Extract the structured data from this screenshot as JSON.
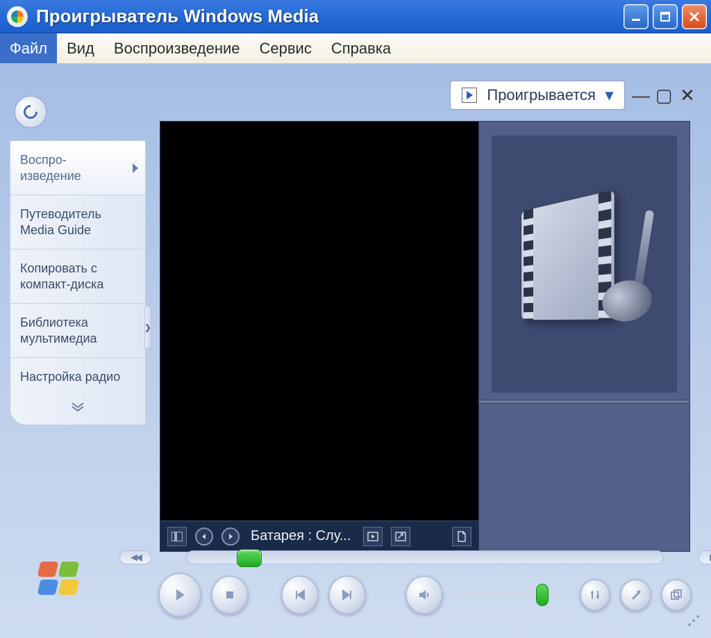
{
  "title": "Проигрыватель Windows Media",
  "menubar": {
    "file": "Файл",
    "view": "Вид",
    "playback": "Воспроизведение",
    "tools": "Сервис",
    "help": "Справка"
  },
  "nowPlayingDropdown": {
    "label": "Проигрывается"
  },
  "sidebar": {
    "tabs": [
      {
        "label": "Воспро-\nизведение"
      },
      {
        "label": "Путеводитель Media Guide"
      },
      {
        "label": "Копировать с компакт-диска"
      },
      {
        "label": "Библиотека мультимедиа"
      },
      {
        "label": "Настройка радио"
      }
    ]
  },
  "statusbar": {
    "text": "Батарея : Слу..."
  },
  "artwork": {
    "icon": "film-music-icon"
  },
  "transport": {
    "rewind": "rewind",
    "forward": "forward"
  }
}
